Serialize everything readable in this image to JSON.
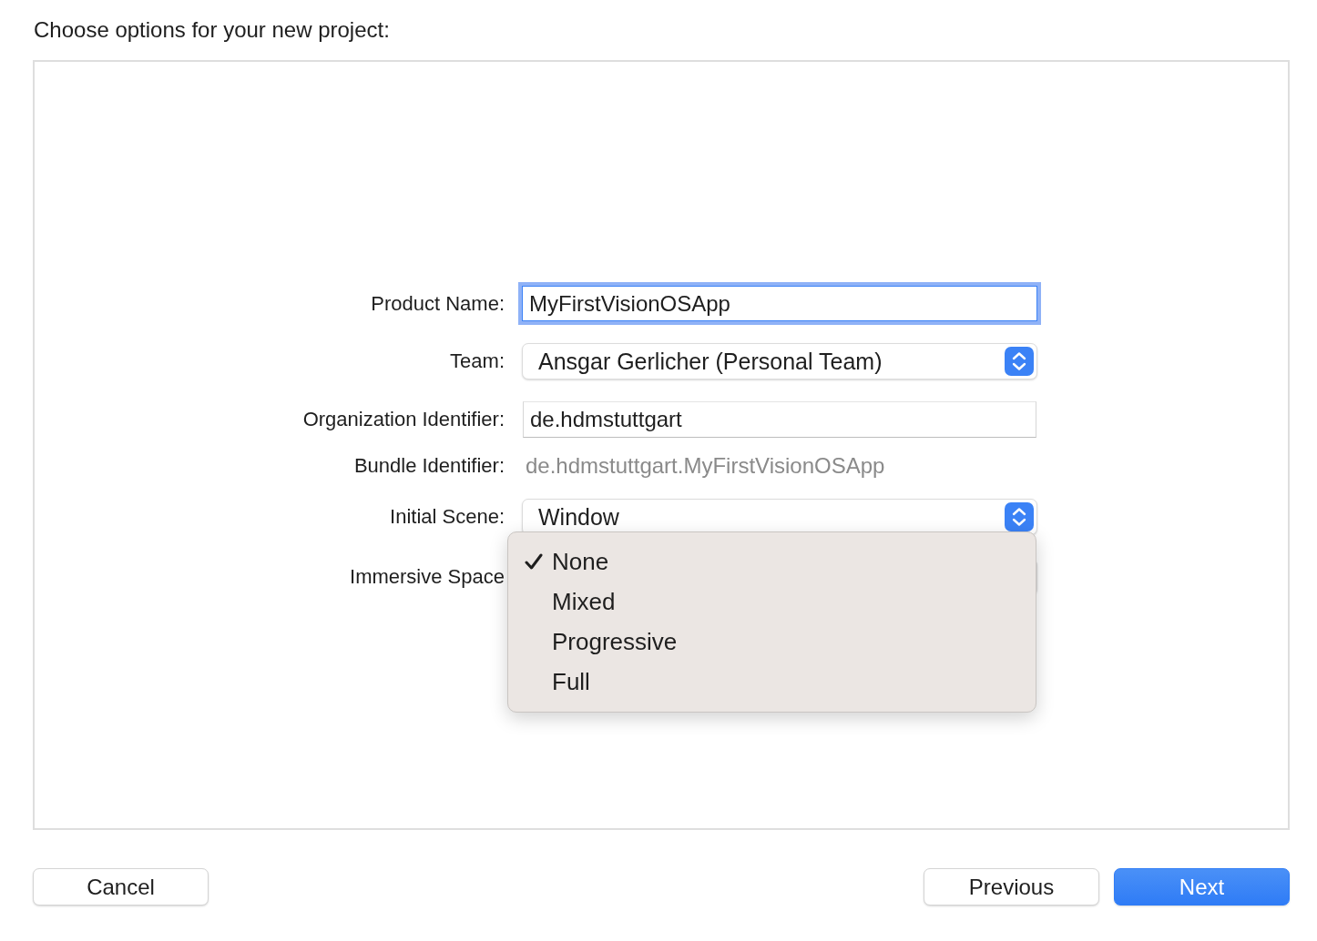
{
  "title": "Choose options for your new project:",
  "fields": [
    {
      "label": "Product Name:",
      "kind": "text",
      "value": "MyFirstVisionOSApp",
      "focused": true
    },
    {
      "label": "Team:",
      "kind": "popup",
      "value": "Ansgar Gerlicher (Personal Team)"
    },
    {
      "label": "Organization Identifier:",
      "kind": "text",
      "value": "de.hdmstuttgart",
      "focused": false
    },
    {
      "label": "Bundle Identifier:",
      "kind": "static",
      "value": "de.hdmstuttgart.MyFirstVisionOSApp"
    },
    {
      "label": "Initial Scene:",
      "kind": "popup",
      "value": "Window"
    },
    {
      "label": "Immersive Space",
      "kind": "popup",
      "menu": [
        {
          "label": "None",
          "selected": true
        },
        {
          "label": "Mixed",
          "selected": false
        },
        {
          "label": "Progressive",
          "selected": false
        },
        {
          "label": "Full",
          "selected": false
        }
      ]
    }
  ],
  "buttons": [
    {
      "label": "Cancel",
      "kind": "secondary"
    },
    {
      "label": "Previous",
      "kind": "secondary"
    },
    {
      "label": "Next",
      "kind": "primary"
    }
  ]
}
